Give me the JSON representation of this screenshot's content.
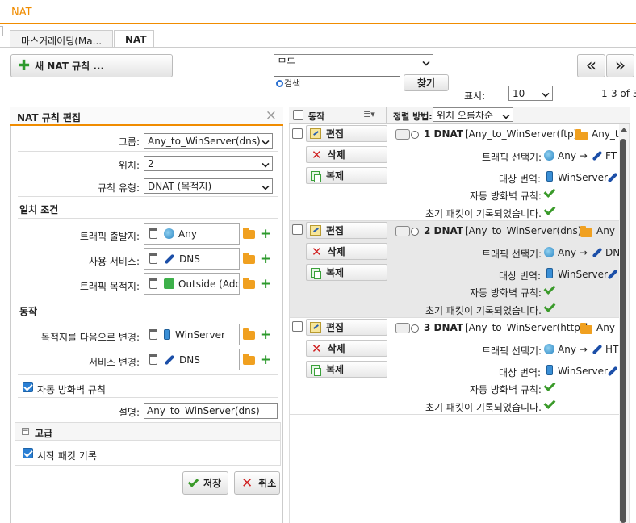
{
  "app": {
    "title": "NAT",
    "accent": "#f08c00"
  },
  "tabs": [
    {
      "label": "마스커레이딩(Ma..."
    },
    {
      "label": "NAT"
    }
  ],
  "toolbar": {
    "new_rule_label": "새 NAT 규칙 ...",
    "filter_select": "모두",
    "search_placeholder": "검색",
    "search_button": "찾기",
    "prev_label": "«",
    "next_label": "»",
    "display_label": "표시:",
    "display_count": "10",
    "range_text": "1-3 of 3"
  },
  "editor": {
    "title": "NAT 규칙 편집",
    "group_label": "그룹:",
    "group_value": "Any_to_WinServer(dns)",
    "position_label": "위치:",
    "position_value": "2",
    "rule_type_label": "규칙 유형:",
    "rule_type_value": "DNAT (목적지)",
    "match_section": "일치 조건",
    "source_label": "트래픽 출발지:",
    "source_value": "Any",
    "service_label": "사용 서비스:",
    "service_value": "DNS",
    "dest_label": "트래픽 목적지:",
    "dest_value": "Outside (Addr",
    "action_section": "동작",
    "change_dest_label": "목적지를 다음으로 변경:",
    "change_dest_value": "WinServer",
    "change_service_label": "서비스 변경:",
    "change_service_value": "DNS",
    "auto_fw_label": "자동 방화벽 규칙",
    "desc_label": "설명:",
    "desc_value": "Any_to_WinServer(dns)",
    "advanced_label": "고급",
    "log_initial_label": "시작 패킷 기록",
    "save_label": "저장",
    "cancel_label": "취소"
  },
  "list": {
    "header_action": "동작",
    "header_sort": "정렬 방법:",
    "sort_value": "위치 오름차순",
    "edit_label": "편집",
    "delete_label": "삭제",
    "copy_label": "복제",
    "traffic_selector_label": "트래픽 선택기:",
    "dest_translation_label": "대상 번역:",
    "auto_fw_label": "자동 방화벽 규칙:",
    "log_initial_label": "초기 패킷이 기록되었습니다.",
    "rules": [
      {
        "title": "1 DNAT",
        "name": "[Any_to_WinServer(ftp)]",
        "group": "Any_t",
        "selector": "Any →",
        "service": "FT",
        "target": "WinServer"
      },
      {
        "title": "2 DNAT",
        "name": "[Any_to_WinServer(dns)]",
        "group": "Any_",
        "selector": "Any →",
        "service": "DN",
        "target": "WinServer"
      },
      {
        "title": "3 DNAT",
        "name": "[Any_to_WinServer(http)]",
        "group": "Any_",
        "selector": "Any →",
        "service": "HT",
        "target": "WinServer"
      }
    ]
  }
}
